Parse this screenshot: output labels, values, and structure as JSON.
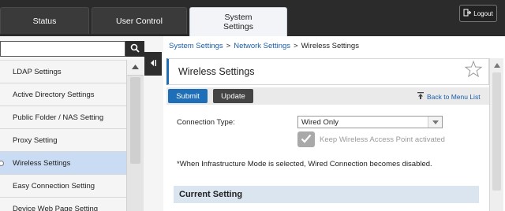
{
  "header": {
    "tabs": [
      {
        "label": "Status"
      },
      {
        "label": "User Control"
      },
      {
        "label": "System\nSettings"
      }
    ],
    "logout_label": "Logout",
    "icons": {
      "logout": "logout-door-icon"
    }
  },
  "sidebar": {
    "search": {
      "value": "",
      "placeholder": ""
    },
    "icons": {
      "search": "search-icon",
      "collapse": "collapse-left-icon",
      "scroll_up": "scroll-up-arrow-icon",
      "selected": "selected-dot-icon"
    },
    "items": [
      {
        "label": "LDAP Settings"
      },
      {
        "label": "Active Directory Settings"
      },
      {
        "label": "Public Folder / NAS Setting"
      },
      {
        "label": "Proxy Setting"
      },
      {
        "label": "Wireless Settings"
      },
      {
        "label": "Easy Connection Setting"
      },
      {
        "label": "Device Web Page Setting"
      }
    ],
    "active_index": 4
  },
  "breadcrumb": {
    "items": [
      "System Settings",
      "Network Settings",
      "Wireless Settings"
    ],
    "separator": ">"
  },
  "page": {
    "title": "Wireless Settings",
    "icons": {
      "favorite": "star-icon",
      "back": "back-arrow-icon",
      "dropdown": "chevron-down-icon",
      "check": "check-icon"
    }
  },
  "toolbar": {
    "submit_label": "Submit",
    "update_label": "Update",
    "back_label": "Back to Menu List"
  },
  "form": {
    "connection_type_label": "Connection Type:",
    "connection_type_value": "Wired Only",
    "keep_wireless_label": "Keep Wireless Access Point activated",
    "keep_wireless_checked": true,
    "keep_wireless_disabled": true,
    "note": "*When Infrastructure Mode is selected, Wired Connection becomes disabled."
  },
  "current_setting": {
    "heading": "Current Setting"
  },
  "colors": {
    "accent": "#1f6fb8",
    "topbar": "#2b2b2b",
    "active_menu": "#c9dcf4",
    "section_bg": "#dbe5f0"
  }
}
